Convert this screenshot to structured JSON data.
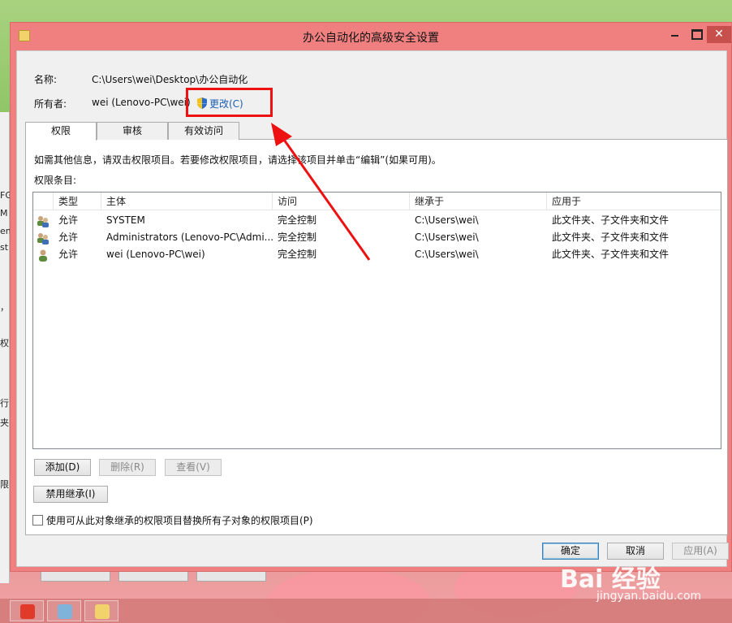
{
  "window": {
    "title": "办公自动化的高级安全设置",
    "close_glyph": "✕"
  },
  "info": {
    "name_label": "名称:",
    "name_value": "C:\\Users\\wei\\Desktop\\办公自动化",
    "owner_label": "所有者:",
    "owner_value": "wei (Lenovo-PC\\wei)",
    "change_link": "更改(C)"
  },
  "tabs": [
    {
      "label": "权限",
      "active": true
    },
    {
      "label": "审核",
      "active": false
    },
    {
      "label": "有效访问",
      "active": false
    }
  ],
  "panel": {
    "hint": "如需其他信息，请双击权限项目。若要修改权限项目，请选择该项目并单击“编辑”(如果可用)。",
    "entries_label": "权限条目:"
  },
  "list": {
    "headers": [
      "类型",
      "主体",
      "访问",
      "继承于",
      "应用于"
    ],
    "rows": [
      {
        "icon": "group-users-icon",
        "type": "允许",
        "principal": "SYSTEM",
        "access": "完全控制",
        "inherited": "C:\\Users\\wei\\",
        "applies": "此文件夹、子文件夹和文件"
      },
      {
        "icon": "group-users-icon",
        "type": "允许",
        "principal": "Administrators (Lenovo-PC\\Admi...",
        "access": "完全控制",
        "inherited": "C:\\Users\\wei\\",
        "applies": "此文件夹、子文件夹和文件"
      },
      {
        "icon": "user-icon",
        "type": "允许",
        "principal": "wei (Lenovo-PC\\wei)",
        "access": "完全控制",
        "inherited": "C:\\Users\\wei\\",
        "applies": "此文件夹、子文件夹和文件"
      }
    ]
  },
  "buttons": {
    "add": "添加(D)",
    "remove": "删除(R)",
    "view": "查看(V)",
    "disable_inheritance": "禁用继承(I)",
    "ok": "确定",
    "cancel": "取消",
    "apply": "应用(A)"
  },
  "checkbox": {
    "label": "使用可从此对象继承的权限项目替换所有子对象的权限项目(P)",
    "checked": false
  },
  "background_window": {
    "fragments": [
      "FG",
      "M",
      "enc",
      "st",
      "，",
      "权",
      "行",
      "夹",
      "限"
    ]
  },
  "watermark": {
    "main": "Bai 经验",
    "sub": "jingyan.baidu.com"
  },
  "colors": {
    "title_bar": "#f08080",
    "highlight": "#e11111",
    "link": "#1a5fb4"
  }
}
